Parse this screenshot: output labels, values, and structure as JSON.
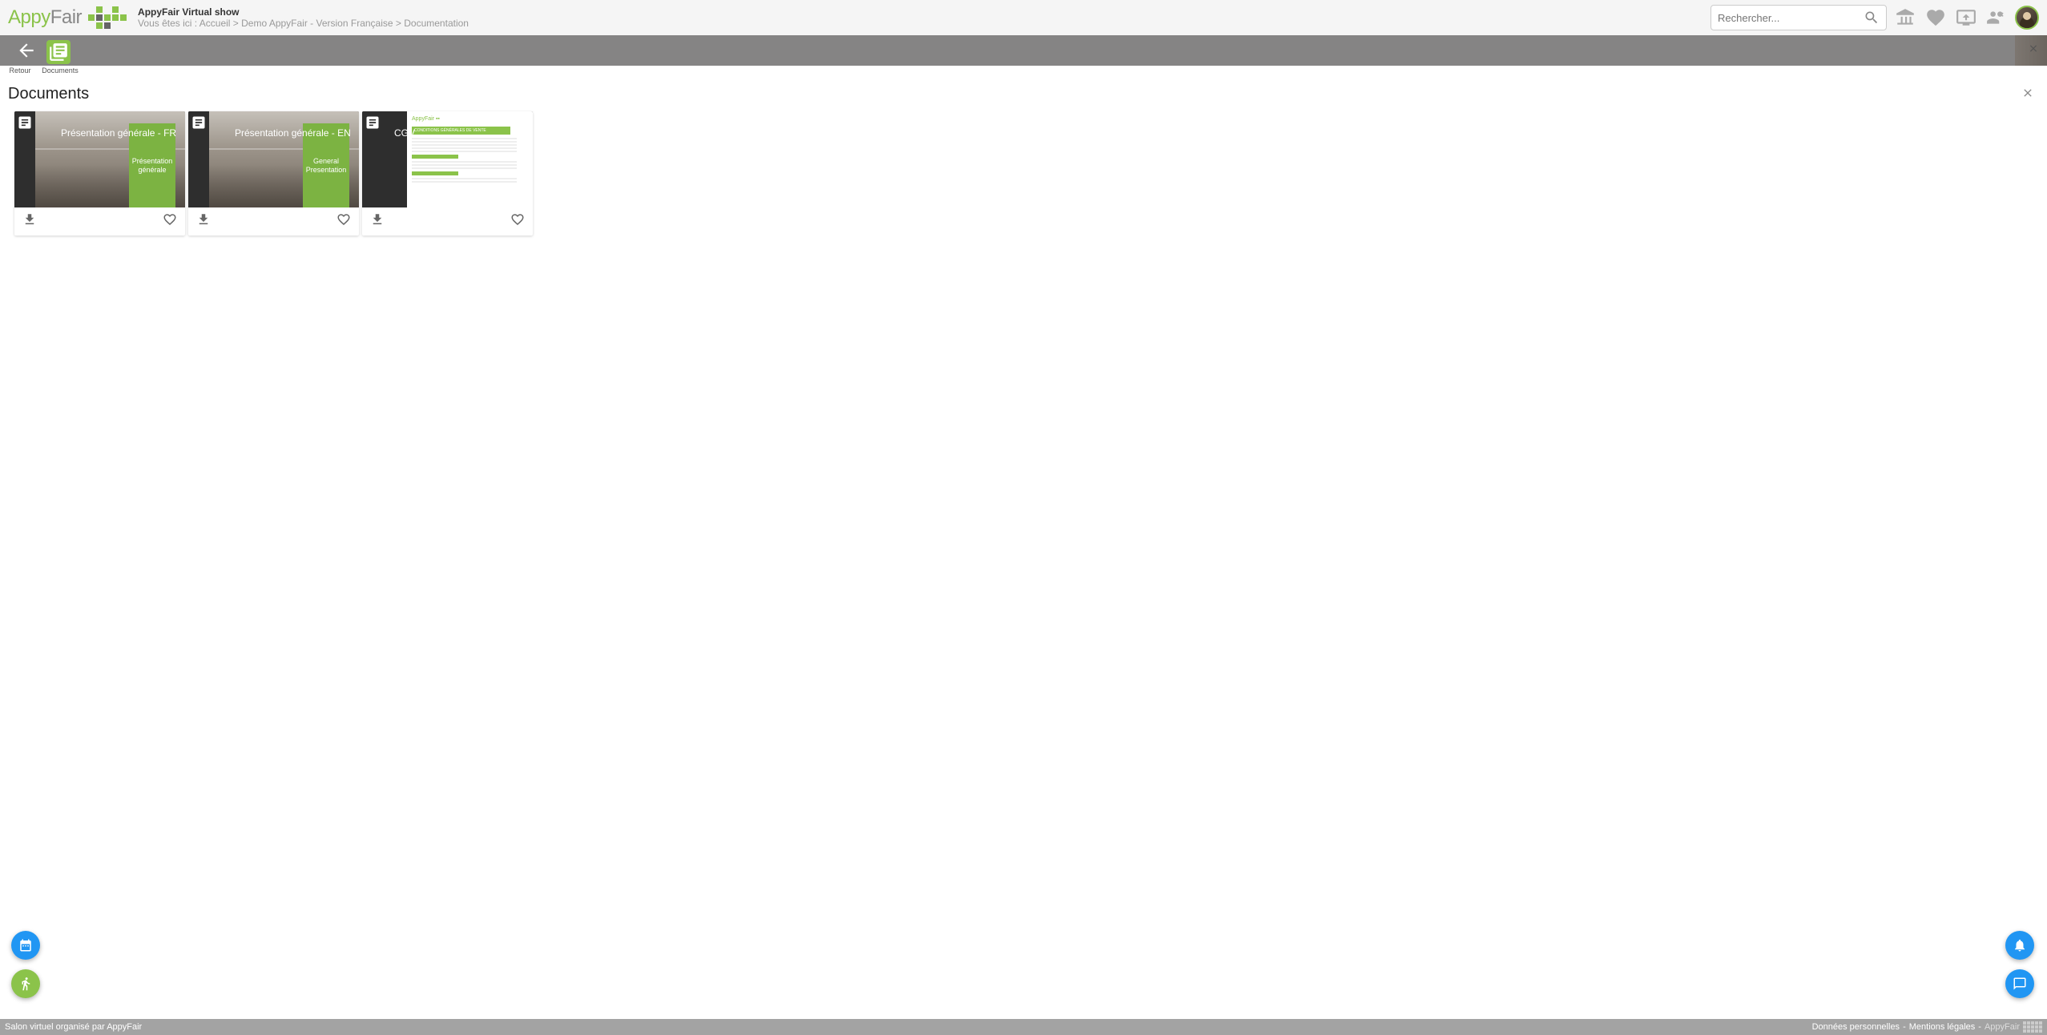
{
  "header": {
    "logo_appy": "Appy",
    "logo_fair": "Fair",
    "show_name": "AppyFair Virtual show",
    "breadcrumb_prefix": "Vous êtes ici :",
    "breadcrumb_parts": [
      "Accueil",
      "Demo AppyFair - Version Française",
      "Documentation"
    ],
    "search_placeholder": "Rechercher..."
  },
  "tabs": {
    "items": [
      {
        "icon": "back-icon",
        "label": "Retour"
      },
      {
        "icon": "documents-icon",
        "label": "Documents",
        "active": true
      }
    ]
  },
  "panel": {
    "title": "Documents"
  },
  "documents": [
    {
      "title": "Présentation générale - FR",
      "preview_type": "building",
      "preview_caption": "Présentation générale"
    },
    {
      "title": "Présentation générale - EN",
      "preview_type": "building",
      "preview_caption": "General Presentation"
    },
    {
      "title": "CGV",
      "preview_type": "whitedoc",
      "preview_caption": "CONDITIONS GÉNÉRALES DE VENTE"
    }
  ],
  "footer": {
    "left_text": "Salon virtuel organisé par AppyFair",
    "links": [
      "Données personnelles",
      "Mentions légales"
    ],
    "brand": "AppyFair"
  }
}
